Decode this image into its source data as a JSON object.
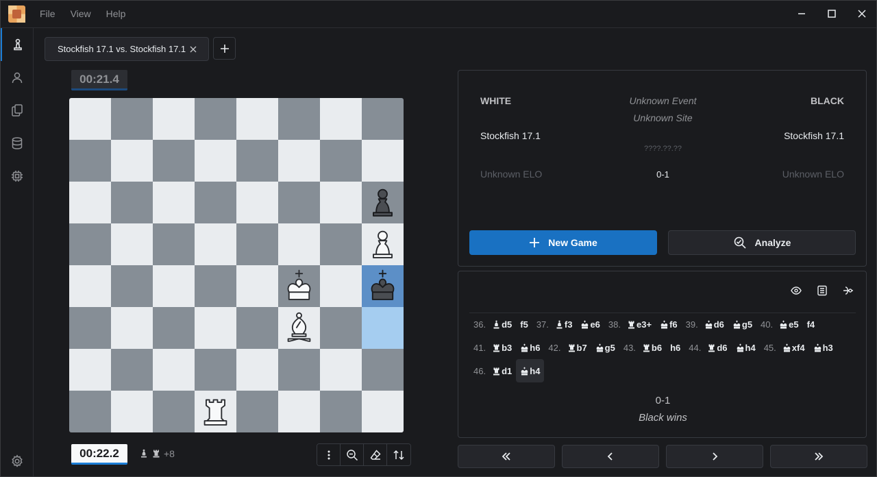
{
  "menu": {
    "file": "File",
    "view": "View",
    "help": "Help"
  },
  "tab": {
    "label": "Stockfish 17.1 vs. Stockfish 17.1"
  },
  "clocks": {
    "top": "00:21.4",
    "bottom": "00:22.2"
  },
  "material": {
    "advantage": "+8"
  },
  "game_info": {
    "white_header": "WHITE",
    "black_header": "BLACK",
    "event": "Unknown Event",
    "site": "Unknown Site",
    "white_player": "Stockfish 17.1",
    "black_player": "Stockfish 17.1",
    "date": "????.??.??",
    "white_elo": "Unknown ELO",
    "black_elo": "Unknown ELO",
    "result": "0-1"
  },
  "buttons": {
    "new_game": "New Game",
    "analyze": "Analyze"
  },
  "moves": [
    [
      {
        "num": "36.",
        "white": {
          "piece": "bishop",
          "text": "d5"
        },
        "black": {
          "piece": "",
          "text": "f5"
        }
      },
      {
        "num": "37.",
        "white": {
          "piece": "bishop",
          "text": "f3"
        },
        "black": {
          "piece": "king",
          "text": "e6"
        }
      },
      {
        "num": "38.",
        "white": {
          "piece": "rook",
          "text": "e3+"
        },
        "black": {
          "piece": "king",
          "text": "f6"
        }
      },
      {
        "num": "39.",
        "white": {
          "piece": "king",
          "text": "d6"
        },
        "black": {
          "piece": "king",
          "text": "g5"
        }
      },
      {
        "num": "40.",
        "white": {
          "piece": "king",
          "text": "e5"
        },
        "black": {
          "piece": "",
          "text": "f4"
        }
      }
    ],
    [
      {
        "num": "41.",
        "white": {
          "piece": "rook",
          "text": "b3"
        },
        "black": {
          "piece": "king",
          "text": "h6"
        }
      },
      {
        "num": "42.",
        "white": {
          "piece": "rook",
          "text": "b7"
        },
        "black": {
          "piece": "king",
          "text": "g5"
        }
      },
      {
        "num": "43.",
        "white": {
          "piece": "rook",
          "text": "b6"
        },
        "black": {
          "piece": "",
          "text": "h6"
        }
      },
      {
        "num": "44.",
        "white": {
          "piece": "rook",
          "text": "d6"
        },
        "black": {
          "piece": "king",
          "text": "h4"
        }
      },
      {
        "num": "45.",
        "white": {
          "piece": "king",
          "text": "xf4"
        },
        "black": {
          "piece": "king",
          "text": "h3"
        }
      }
    ],
    [
      {
        "num": "46.",
        "white": {
          "piece": "rook",
          "text": "d1"
        },
        "black": {
          "piece": "king",
          "text": "h4",
          "current": true
        }
      }
    ]
  ],
  "game_result": {
    "score": "0-1",
    "text": "Black wins"
  },
  "board": {
    "highlight": [
      "h4",
      "h3"
    ],
    "pieces": [
      {
        "square": "h6",
        "type": "pawn",
        "color": "black"
      },
      {
        "square": "h5",
        "type": "pawn",
        "color": "white"
      },
      {
        "square": "f4",
        "type": "king",
        "color": "white"
      },
      {
        "square": "h4",
        "type": "king",
        "color": "black"
      },
      {
        "square": "f3",
        "type": "bishop",
        "color": "white"
      },
      {
        "square": "d1",
        "type": "rook",
        "color": "white"
      }
    ]
  },
  "colors": {
    "accent": "#1971c2",
    "light_square": "#e9ecef",
    "dark_square": "#868e96"
  }
}
